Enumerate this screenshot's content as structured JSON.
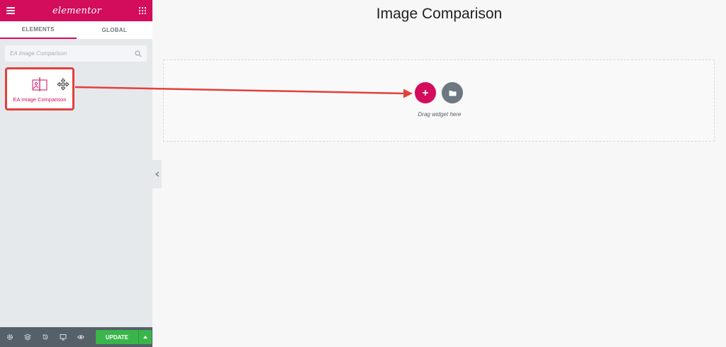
{
  "panel": {
    "logo": "elementor",
    "tabs": [
      {
        "label": "ELEMENTS",
        "active": true
      },
      {
        "label": "GLOBAL",
        "active": false
      }
    ],
    "search": {
      "placeholder": "EA Image Comparison",
      "value": ""
    },
    "widgets": [
      {
        "label": "EA Image Comparison",
        "icon": "image-comparison-icon"
      }
    ],
    "footer": {
      "icons": [
        "settings-icon",
        "layers-icon",
        "history-icon",
        "responsive-icon",
        "preview-icon"
      ],
      "update_label": "UPDATE"
    }
  },
  "canvas": {
    "page_title": "Image Comparison",
    "drop_zone_text": "Drag widget here"
  },
  "colors": {
    "brand": "#d30c5c",
    "highlight": "#e2403c",
    "update": "#39b54a",
    "footer_bg": "#556068"
  }
}
